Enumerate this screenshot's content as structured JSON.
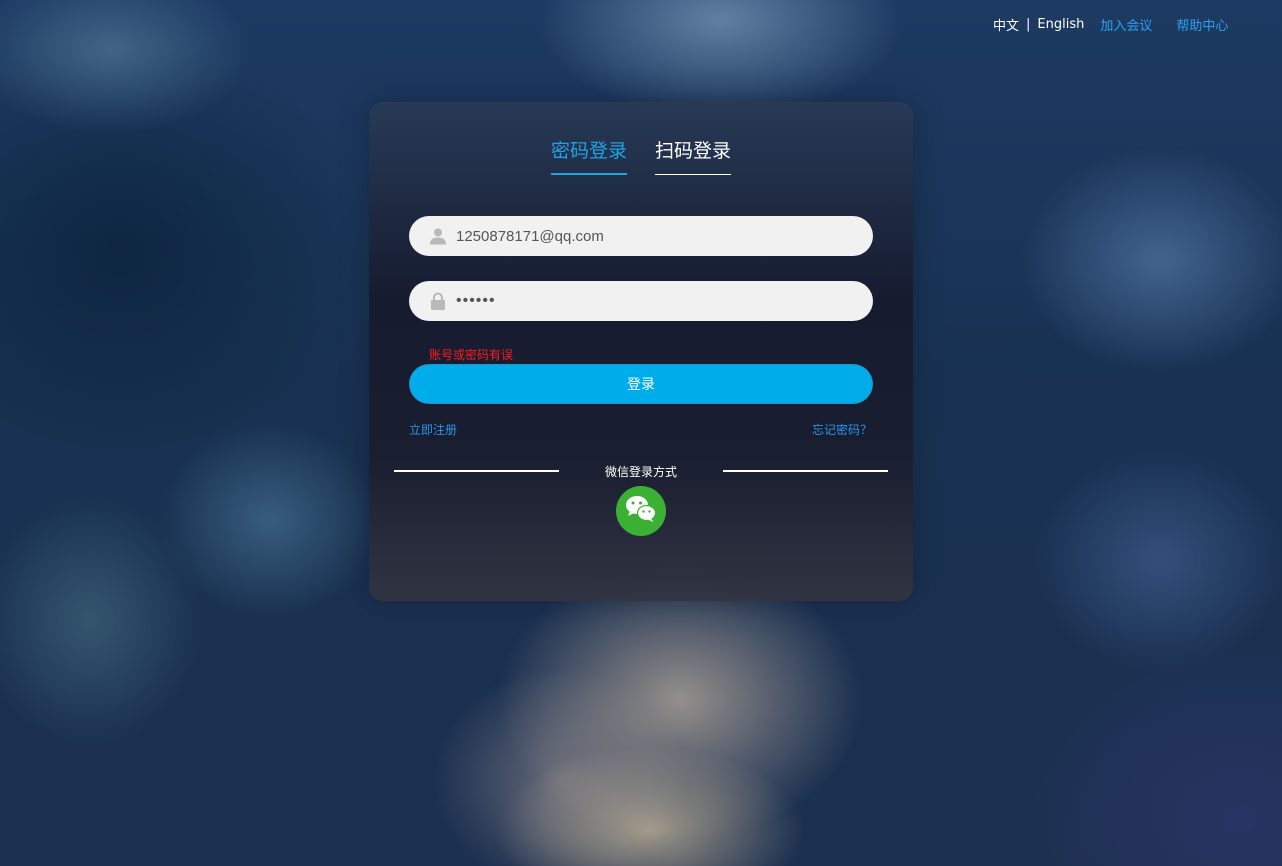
{
  "top_nav": {
    "lang_zh": "中文",
    "separator": "|",
    "lang_en": "English",
    "join_meeting": "加入会议",
    "help_center": "帮助中心"
  },
  "login": {
    "tabs": [
      {
        "label": "密码登录",
        "active": true
      },
      {
        "label": "扫码登录",
        "active": false
      }
    ],
    "username": {
      "value": "1250878171@qq.com",
      "icon": "user-icon"
    },
    "password": {
      "value": "••••••",
      "icon": "lock-icon"
    },
    "error_message": "账号或密码有误",
    "submit_label": "登录",
    "register_link": "立即注册",
    "forgot_link": "忘记密码？",
    "wechat_label": "微信登录方式",
    "wechat_icon": "wechat-icon"
  },
  "colors": {
    "accent": "#00adeb",
    "link": "#2a95e8",
    "error": "#ff1a1a",
    "wechat": "#3cb034"
  }
}
